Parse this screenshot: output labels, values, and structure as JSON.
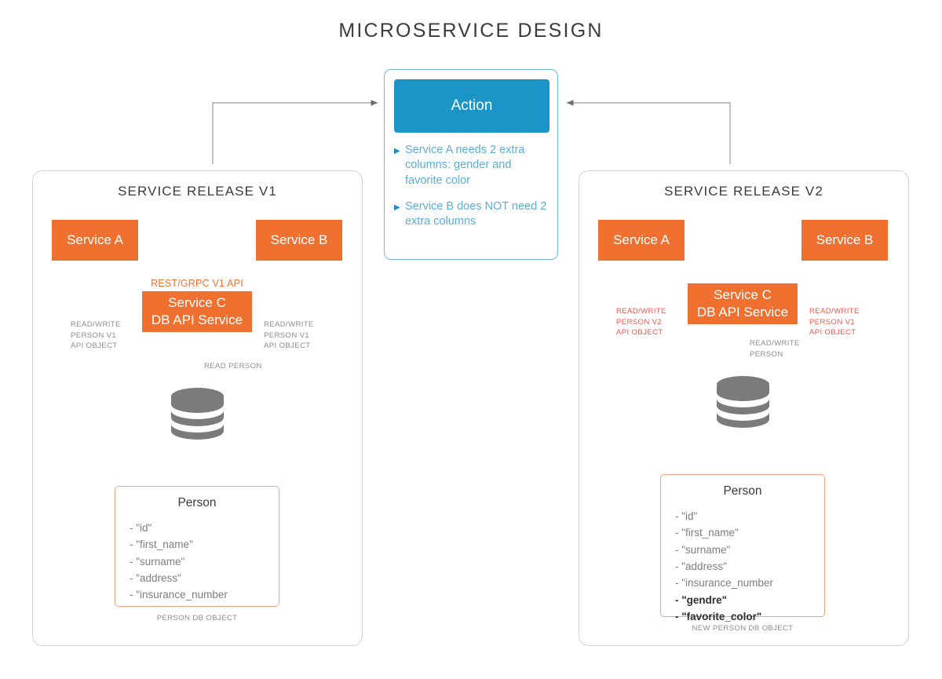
{
  "title": "MICROSERVICE DESIGN",
  "colors": {
    "orange": "#F0702F",
    "blue": "#1B94C8",
    "blue_text": "#5AAED7",
    "red_label": "#F4554A",
    "gray_label": "#8D8D8D",
    "panel_border": "#D2D2D2",
    "entity_border": "#F4A283",
    "db_gray": "#7B7B7B",
    "wire_gray": "#9A9A9A"
  },
  "action": {
    "header_label": "Action",
    "bullet_icon": "triangle-right-icon",
    "items": [
      "Service A needs 2 extra columns: gender and favorite color",
      "Service B does NOT need 2 extra columns"
    ]
  },
  "v1": {
    "panel_title": "SERVICE RELEASE V1",
    "service_a": "Service A",
    "service_b": "Service B",
    "service_c_line1": "Service C",
    "service_c_line2": "DB API Service",
    "api_label": "REST/GRPC V1 API",
    "label_a": "READ/WRITE\nPERSON V1\nAPI OBJECT",
    "label_b": "READ/WRITE\nPERSON V1\nAPI OBJECT",
    "label_db": "READ PERSON",
    "db_icon": "database-cylinder-icon",
    "entity": {
      "name": "Person",
      "fields": [
        {
          "text": "- \"id\"",
          "bold": false
        },
        {
          "text": "- \"first_name\"",
          "bold": false
        },
        {
          "text": "- \"surname\"",
          "bold": false
        },
        {
          "text": "- \"address\"",
          "bold": false
        },
        {
          "text": "- \"insurance_number",
          "bold": false
        }
      ],
      "caption": "PERSON DB OBJECT"
    }
  },
  "v2": {
    "panel_title": "SERVICE RELEASE V2",
    "service_a": "Service A",
    "service_b": "Service B",
    "service_c_line1": "Service C",
    "service_c_line2": "DB API Service",
    "label_a": "READ/WRITE\nPERSON V2\nAPI OBJECT",
    "label_b": "READ/WRITE\nPERSON V1\nAPI OBJECT",
    "label_db": "READ/WRITE\nPERSON",
    "db_icon": "database-cylinder-icon",
    "entity": {
      "name": "Person",
      "fields": [
        {
          "text": "- \"id\"",
          "bold": false
        },
        {
          "text": "- \"first_name\"",
          "bold": false
        },
        {
          "text": "- \"surname\"",
          "bold": false
        },
        {
          "text": "- \"address\"",
          "bold": false
        },
        {
          "text": "- \"insurance_number",
          "bold": false
        },
        {
          "text": "- \"gendre\"",
          "bold": true
        },
        {
          "text": "- \"favorite_color\"",
          "bold": true
        }
      ],
      "caption": "NEW PERSON DB OBJECT"
    }
  }
}
